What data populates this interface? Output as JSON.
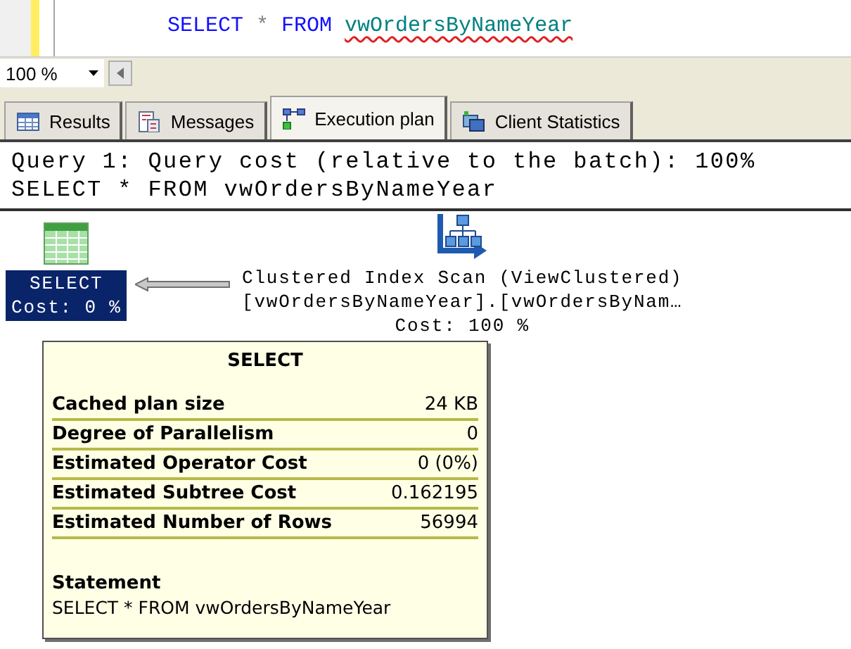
{
  "editor": {
    "code": [
      {
        "kind": "keyword",
        "text": "SELECT"
      },
      {
        "kind": "operator",
        "text": "*"
      },
      {
        "kind": "keyword",
        "text": "FROM"
      },
      {
        "kind": "identifier",
        "text": "vwOrdersByNameYear",
        "misspelled": true
      }
    ]
  },
  "zoom": {
    "value": "100 %"
  },
  "tabs": [
    {
      "kind": "results",
      "label": "Results",
      "selected": false
    },
    {
      "kind": "messages",
      "label": "Messages",
      "selected": false
    },
    {
      "kind": "plan",
      "label": "Execution plan",
      "selected": true
    },
    {
      "kind": "stats",
      "label": "Client Statistics",
      "selected": false
    }
  ],
  "plan": {
    "header": [
      "Query 1: Query cost (relative to the batch): 100%",
      "SELECT * FROM vwOrdersByNameYear"
    ],
    "operators": [
      {
        "kind": "select",
        "lines": [
          "SELECT",
          "Cost: 0 %"
        ],
        "selected": true
      },
      {
        "kind": "index-scan",
        "lines": [
          "Clustered Index Scan (ViewClustered)",
          "[vwOrdersByNameYear].[vwOrdersByNam…",
          "Cost: 100 %"
        ],
        "selected": false
      }
    ]
  },
  "tooltip": {
    "title": "SELECT",
    "properties": [
      {
        "name": "Cached plan size",
        "value": "24 KB"
      },
      {
        "name": "Degree of Parallelism",
        "value": "0"
      },
      {
        "name": "Estimated Operator Cost",
        "value": "0 (0%)"
      },
      {
        "name": "Estimated Subtree Cost",
        "value": "0.162195"
      },
      {
        "name": "Estimated Number of Rows",
        "value": "56994"
      }
    ],
    "statement_label": "Statement",
    "statement": "SELECT * FROM vwOrdersByNameYear"
  }
}
